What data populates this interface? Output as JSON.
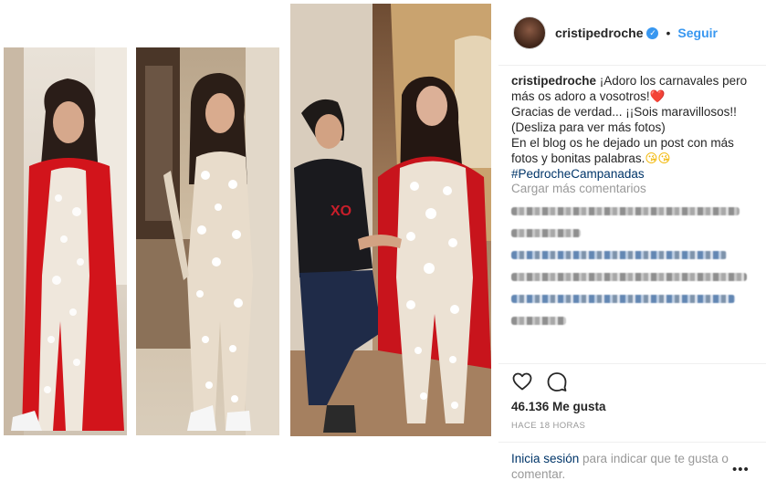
{
  "post": {
    "username": "cristipedroche",
    "verified_badge": "✓",
    "separator": "•",
    "follow_label": "Seguir",
    "caption_user": "cristipedroche",
    "caption_line1": " ¡Adoro los carnavales pero más os adoro a vosotros!",
    "caption_heart": "❤️",
    "caption_line2": "Gracias de verdad... ¡¡Sois maravillosos!!",
    "caption_line3": "(Desliza para ver más fotos)",
    "caption_line4": "En el blog os he dejado un post con más fotos y bonitas palabras.",
    "caption_emojis": "😘😘",
    "hashtag": "#PedrocheCampanadas",
    "load_more": "Cargar más comentarios",
    "likes": "46.136 Me gusta",
    "time_ago": "HACE 18 HORAS",
    "login_link": "Inicia sesión",
    "login_text": " para indicar que te gusta o comentar.",
    "more_options": "•••"
  },
  "icons": {
    "verified": "verified-badge-icon",
    "like": "heart-outline-icon",
    "comment": "comment-bubble-icon",
    "options": "more-options-icon"
  },
  "colors": {
    "link_blue": "#3897f0",
    "hashtag_navy": "#003569",
    "muted_gray": "#999999",
    "text": "#262626",
    "cape_red": "#d0141a"
  }
}
